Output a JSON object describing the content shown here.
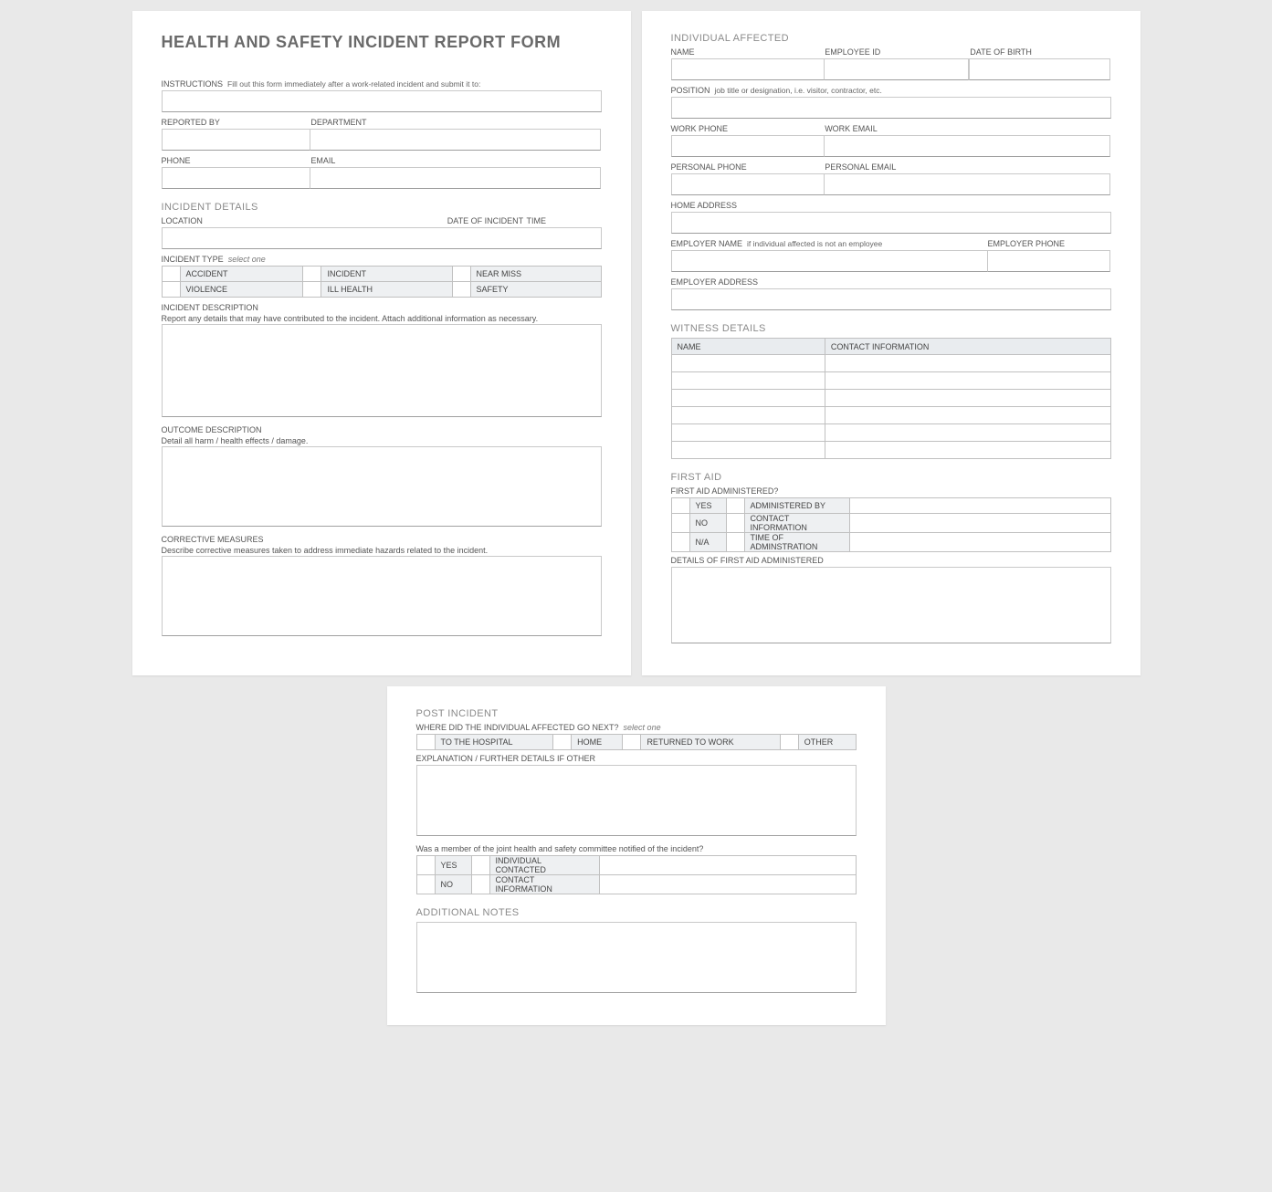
{
  "title": "HEALTH AND SAFETY INCIDENT REPORT FORM",
  "instructions": {
    "label": "INSTRUCTIONS",
    "hint": "Fill out this form immediately after a work-related incident and submit it to:"
  },
  "reporter": {
    "reported_by": "REPORTED BY",
    "department": "DEPARTMENT",
    "phone": "PHONE",
    "email": "EMAIL"
  },
  "incident_details": {
    "heading": "INCIDENT DETAILS",
    "location": "LOCATION",
    "date": "DATE OF INCIDENT",
    "time": "TIME",
    "type_label": "INCIDENT TYPE",
    "type_hint": "select one",
    "types": [
      "ACCIDENT",
      "INCIDENT",
      "NEAR MISS",
      "VIOLENCE",
      "ILL HEALTH",
      "SAFETY"
    ],
    "desc_label": "INCIDENT DESCRIPTION",
    "desc_note": "Report any details that may have contributed to the incident.  Attach additional information as necessary.",
    "outcome_label": "OUTCOME DESCRIPTION",
    "outcome_note": "Detail all harm / health effects / damage.",
    "corrective_label": "CORRECTIVE MEASURES",
    "corrective_note": "Describe corrective measures taken to address immediate hazards related to the incident."
  },
  "individual": {
    "heading": "INDIVIDUAL AFFECTED",
    "name": "NAME",
    "employee_id": "EMPLOYEE ID",
    "dob": "DATE OF BIRTH",
    "position_label": "POSITION",
    "position_hint": "job title or designation, i.e. visitor, contractor, etc.",
    "work_phone": "WORK PHONE",
    "work_email": "WORK EMAIL",
    "personal_phone": "PERSONAL PHONE",
    "personal_email": "PERSONAL EMAIL",
    "home_address": "HOME ADDRESS",
    "employer_name_label": "EMPLOYER NAME",
    "employer_name_hint": "if individual affected is not an employee",
    "employer_phone": "EMPLOYER PHONE",
    "employer_address": "EMPLOYER ADDRESS"
  },
  "witness": {
    "heading": "WITNESS DETAILS",
    "col_name": "NAME",
    "col_contact": "CONTACT INFORMATION",
    "rows": 6
  },
  "first_aid": {
    "heading": "FIRST AID",
    "administered_q": "FIRST AID ADMINISTERED?",
    "options": [
      "YES",
      "NO",
      "N/A"
    ],
    "administered_by": "ADMINISTERED BY",
    "contact_info": "CONTACT INFORMATION",
    "time_admin": "TIME OF ADMINSTRATION",
    "details_label": "DETAILS OF FIRST AID ADMINISTERED"
  },
  "post_incident": {
    "heading": "POST INCIDENT",
    "where_label": "WHERE DID THE INDIVIDUAL AFFECTED GO NEXT?",
    "where_hint": "select one",
    "where_options": [
      "TO THE HOSPITAL",
      "HOME",
      "RETURNED TO WORK",
      "OTHER"
    ],
    "explanation_label": "EXPLANATION / FURTHER DETAILS IF OTHER",
    "committee_q": "Was a member of the joint health and safety committee notified of the incident?",
    "committee_options": [
      "YES",
      "NO"
    ],
    "individual_contacted": "INDIVIDUAL CONTACTED",
    "contact_info": "CONTACT INFORMATION"
  },
  "additional_notes": {
    "heading": "ADDITIONAL NOTES"
  }
}
